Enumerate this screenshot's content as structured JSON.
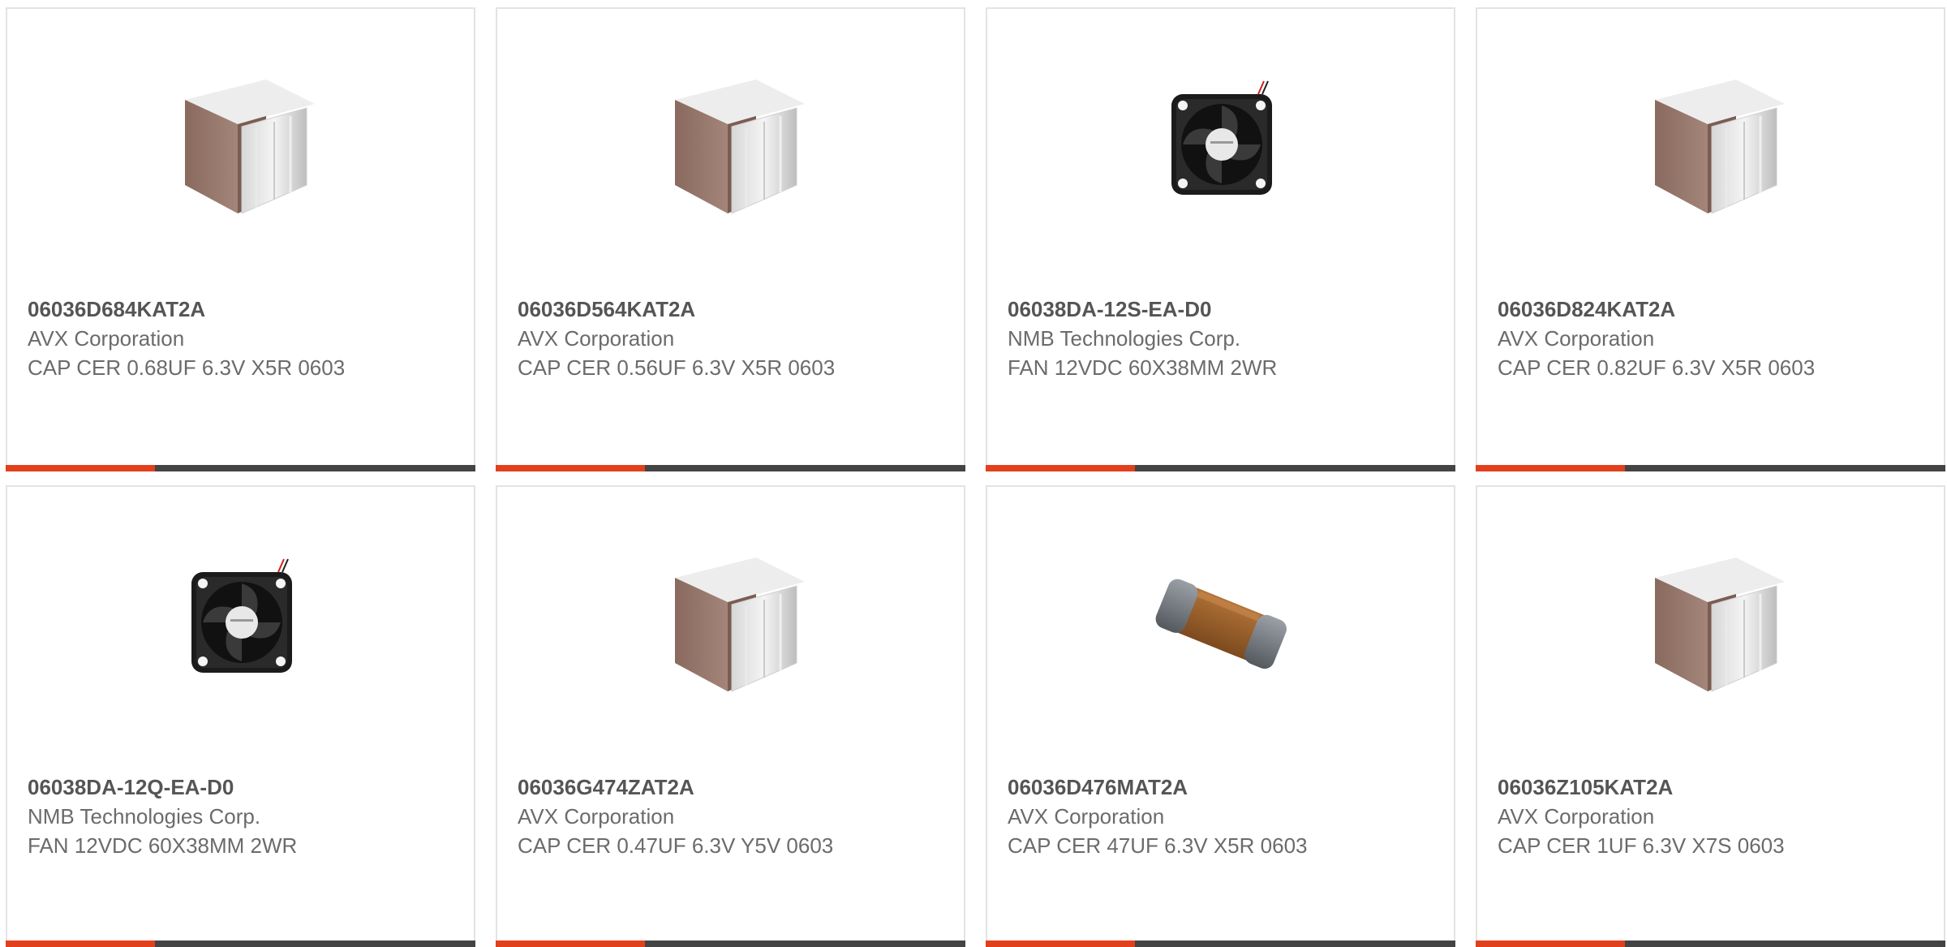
{
  "products": [
    {
      "part_number": "06036D684KAT2A",
      "manufacturer": "AVX Corporation",
      "description": "CAP CER 0.68UF 6.3V X5R 0603",
      "image": "chip-capacitor-icon"
    },
    {
      "part_number": "06036D564KAT2A",
      "manufacturer": "AVX Corporation",
      "description": "CAP CER 0.56UF 6.3V X5R 0603",
      "image": "chip-capacitor-icon"
    },
    {
      "part_number": "06038DA-12S-EA-D0",
      "manufacturer": "NMB Technologies Corp.",
      "description": "FAN 12VDC 60X38MM 2WR",
      "image": "cooling-fan-icon"
    },
    {
      "part_number": "06036D824KAT2A",
      "manufacturer": "AVX Corporation",
      "description": "CAP CER 0.82UF 6.3V X5R 0603",
      "image": "chip-capacitor-icon"
    },
    {
      "part_number": "06038DA-12Q-EA-D0",
      "manufacturer": "NMB Technologies Corp.",
      "description": "FAN 12VDC 60X38MM 2WR",
      "image": "cooling-fan-icon"
    },
    {
      "part_number": "06036G474ZAT2A",
      "manufacturer": "AVX Corporation",
      "description": "CAP CER 0.47UF 6.3V Y5V 0603",
      "image": "chip-capacitor-icon"
    },
    {
      "part_number": "06036D476MAT2A",
      "manufacturer": "AVX Corporation",
      "description": "CAP CER 47UF 6.3V X5R 0603",
      "image": "smd-capacitor-icon"
    },
    {
      "part_number": "06036Z105KAT2A",
      "manufacturer": "AVX Corporation",
      "description": "CAP CER 1UF 6.3V X7S 0603",
      "image": "chip-capacitor-icon"
    }
  ],
  "colors": {
    "accent": "#e2401c",
    "bar": "#444444",
    "border": "#e3e3e3",
    "text": "#6b6b6b"
  }
}
